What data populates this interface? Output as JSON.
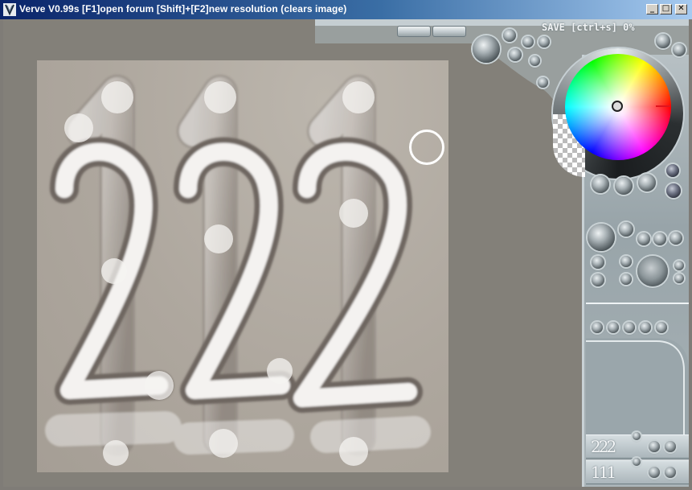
{
  "window": {
    "title": "Verve V0.99s [F1]open forum   [Shift]+[F2]new resolution (clears image)",
    "controls": {
      "minimize": "_",
      "maximize": "□",
      "close": "✕"
    }
  },
  "toolbar": {
    "save_status": "SAVE [ctrl+s] 0%"
  },
  "colors": {
    "selected_hue": "#e0141e",
    "canvas_bg": "#aea79e",
    "stroke_highlight": "#f4f2f0",
    "stroke_shadow": "#6e6660",
    "panel_metal": "#a7b2b7"
  },
  "presets": [
    {
      "label": "222",
      "icons": [
        "preset-load-icon",
        "preset-save-icon"
      ]
    },
    {
      "label": "111",
      "icons": [
        "preset-load-icon",
        "preset-save-icon"
      ]
    }
  ],
  "icons": {
    "app": "verve-logo-icon",
    "cursor": "brush-cursor-icon",
    "color_wheel": "color-wheel-icon"
  }
}
